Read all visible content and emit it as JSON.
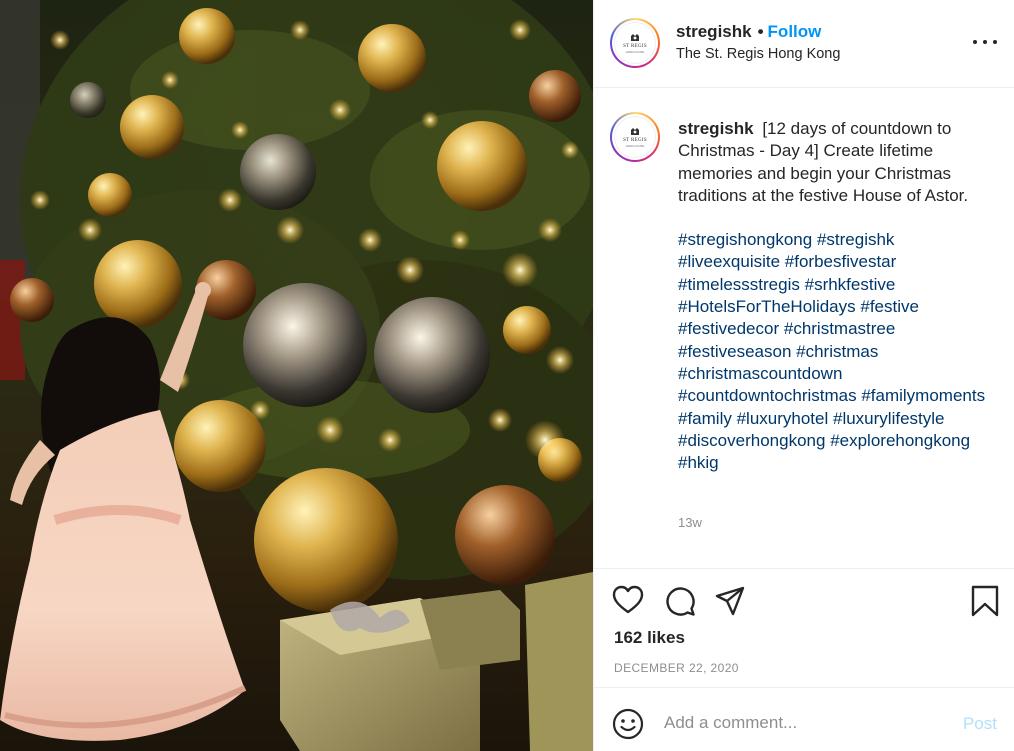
{
  "photo": {
    "alt_icon": "christmas-tree-photo"
  },
  "header": {
    "username": "stregishk",
    "dot": "•",
    "follow_label": "Follow",
    "location": "The St. Regis Hong Kong",
    "avatar_logo_text": "ST REGIS",
    "avatar_logo_sub": "HONG KONG"
  },
  "post": {
    "username": "stregishk",
    "caption": "[12 days of countdown to Christmas - Day 4] Create lifetime memories and begin your Christmas traditions at the festive House of Astor.",
    "hashtags": [
      "#stregishongkong",
      "#stregishk",
      "#liveexquisite",
      "#forbesfivestar",
      "#timelessstregis",
      "#srhkfestive",
      "#HotelsForTheHolidays",
      "#festive",
      "#festivedecor",
      "#christmastree",
      "#festiveseason",
      "#christmas",
      "#christmascountdown",
      "#countdowntochristmas",
      "#familymoments",
      "#family",
      "#luxuryhotel",
      "#luxurylifestyle",
      "#discoverhongkong",
      "#explorehongkong",
      "#hkig"
    ],
    "age": "13w"
  },
  "actions": {
    "icons": [
      "heart-icon",
      "comment-icon",
      "share-icon",
      "bookmark-icon"
    ],
    "likes": "162 likes",
    "date": "DECEMBER 22, 2020"
  },
  "comment": {
    "placeholder": "Add a comment...",
    "post_label": "Post",
    "post_color": "#b2dffc"
  },
  "colors": {
    "link": "#0095f6",
    "hashtag": "#00376b",
    "muted": "#8e8e8e"
  }
}
